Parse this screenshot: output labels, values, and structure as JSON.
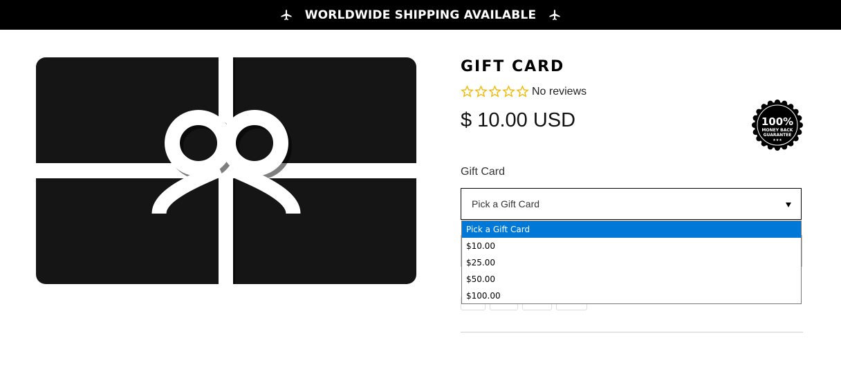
{
  "announcement": {
    "text": "WORLDWIDE SHIPPING AVAILABLE",
    "icon": "airplane-icon"
  },
  "product": {
    "title": "GIFT CARD",
    "rating": {
      "stars_filled": 0,
      "stars_total": 5,
      "reviews_text": "No reviews",
      "star_color": "#f2b705"
    },
    "price": "$ 10.00 USD",
    "badge": {
      "line1": "100%",
      "line2": "MONEY BACK",
      "line3": "GUARANTEE",
      "line4": "★★★"
    }
  },
  "variant": {
    "label": "Gift Card",
    "selected_value": "Pick a Gift Card",
    "options": [
      "Pick a Gift Card",
      "$10.00",
      "$25.00",
      "$50.00",
      "$100.00"
    ],
    "highlighted_index": 0
  },
  "colors": {
    "topbar": "#000000",
    "card": "#151515",
    "ribbon": "#ffffff",
    "highlight": "#0078d7"
  }
}
